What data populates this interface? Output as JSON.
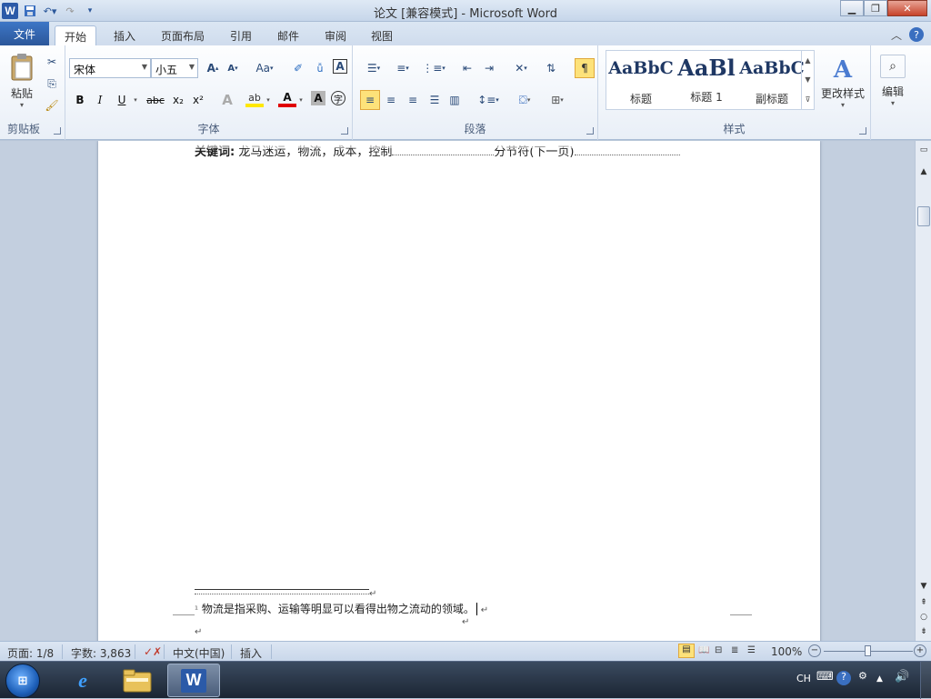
{
  "window": {
    "title": "论文 [兼容模式] - Microsoft Word",
    "app_icon": "W"
  },
  "qat": {
    "save_icon": "save-icon",
    "undo_icon": "undo-icon",
    "redo_icon": "redo-icon"
  },
  "tabs": [
    {
      "label": "文件"
    },
    {
      "label": "开始"
    },
    {
      "label": "插入"
    },
    {
      "label": "页面布局"
    },
    {
      "label": "引用"
    },
    {
      "label": "邮件"
    },
    {
      "label": "审阅"
    },
    {
      "label": "视图"
    }
  ],
  "ribbon": {
    "clipboard": {
      "label": "剪贴板",
      "paste_label": "粘贴"
    },
    "font": {
      "label": "字体",
      "font_name": "宋体",
      "font_size": "小五",
      "bold": "B",
      "italic": "I",
      "underline": "U",
      "strike": "abc",
      "subscript": "x₂",
      "superscript": "x²",
      "grow": "A",
      "shrink": "A",
      "case": "Aa",
      "clear_fmt": "A",
      "color_a": "A",
      "char_shade": "A",
      "enclose": "字"
    },
    "paragraph": {
      "label": "段落"
    },
    "styles": {
      "label": "样式",
      "items": [
        {
          "preview": "AaBbC",
          "name": "标题"
        },
        {
          "preview": "AaBl",
          "name": "标题 1"
        },
        {
          "preview": "AaBbC",
          "name": "副标题"
        }
      ],
      "change_label": "更改样式"
    },
    "editing": {
      "label": "编辑"
    }
  },
  "document": {
    "keywords_label": "关键词:",
    "keywords_text": "龙马迷运，物流，成本，控制",
    "section_break": "分节符(下一页)",
    "footnote_text": "物流是指采购、运输等明显可以看得出物之流动的领域。"
  },
  "status": {
    "page": "页面: 1/8",
    "words": "字数: 3,863",
    "language": "中文(中国)",
    "mode": "插入",
    "zoom": "100%"
  },
  "tray": {
    "lang": "CH"
  }
}
